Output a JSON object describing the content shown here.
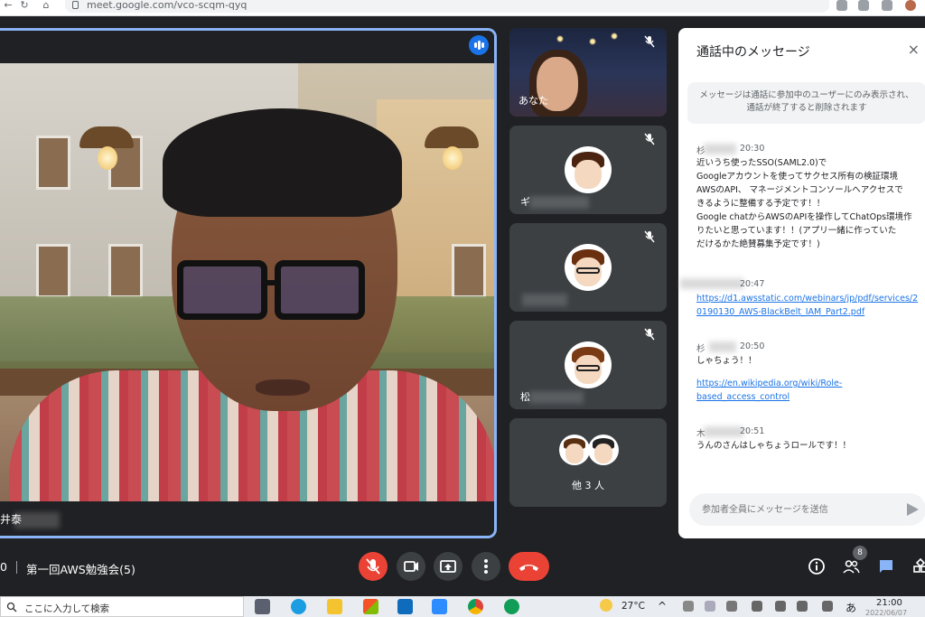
{
  "browser": {
    "url": "meet.google.com/vco-scqm-qyq",
    "nav_back": "←",
    "nav_reload": "↻",
    "nav_home": "⌂"
  },
  "main_speaker": {
    "name": "井泰",
    "speaking_icon": "audio-level-icon"
  },
  "participants": [
    {
      "label": "あなた",
      "muted": true
    },
    {
      "label": "ギ",
      "muted": true
    },
    {
      "label": "",
      "muted": true
    },
    {
      "label": "松",
      "muted": true
    },
    {
      "label": "他 3 人"
    }
  ],
  "chat": {
    "title": "通話中のメッセージ",
    "close_icon": "×",
    "notice_line1": "メッセージは通話に参加中のユーザーにのみ表示され、",
    "notice_line2": "通話が終了すると削除されます",
    "messages": [
      {
        "name": "杉",
        "time": "20:30",
        "lines": [
          "近いうち使ったSSO(SAML2.0)で",
          "Googleアカウントを使ってサクセス所有の検証環境",
          "AWSのAPI、 マネージメントコンソールへアクセスで",
          "きるように整備する予定です！！",
          "Google chatからAWSのAPIを操作してChatOps環境作",
          "りたいと思っています！！(アプリ一緒に作っていた",
          "だけるかた絶賛募集予定です！)"
        ]
      },
      {
        "name": "",
        "time": "20:47",
        "link_lines": [
          "https://d1.awsstatic.com/webinars/jp/pdf/services/2",
          "0190130_AWS-BlackBelt_IAM_Part2.pdf"
        ]
      },
      {
        "name": "杉",
        "time": "20:50",
        "lines": [
          "しゃちょう！！"
        ],
        "link_lines": [
          "https://en.wikipedia.org/wiki/Role-",
          "based_access_control"
        ]
      },
      {
        "name": "木",
        "time": "20:51",
        "lines": [
          "うんのさんはしゃちょうロールです！！"
        ]
      }
    ],
    "input_placeholder": "参加者全員にメッセージを送信"
  },
  "meeting_bar": {
    "time_fragment": "0",
    "meeting_name": "第一回AWS勉強会(5)",
    "participant_count": "8"
  },
  "taskbar": {
    "search_placeholder": "ここに入力して検索",
    "temperature": "27°C",
    "ime": "あ",
    "clock_time": "21:00",
    "clock_date": "2022/06/07"
  },
  "colors": {
    "accent_blue": "#1a73e8",
    "end_call_red": "#ea4335",
    "speaking_outline": "#8ab4f8"
  }
}
